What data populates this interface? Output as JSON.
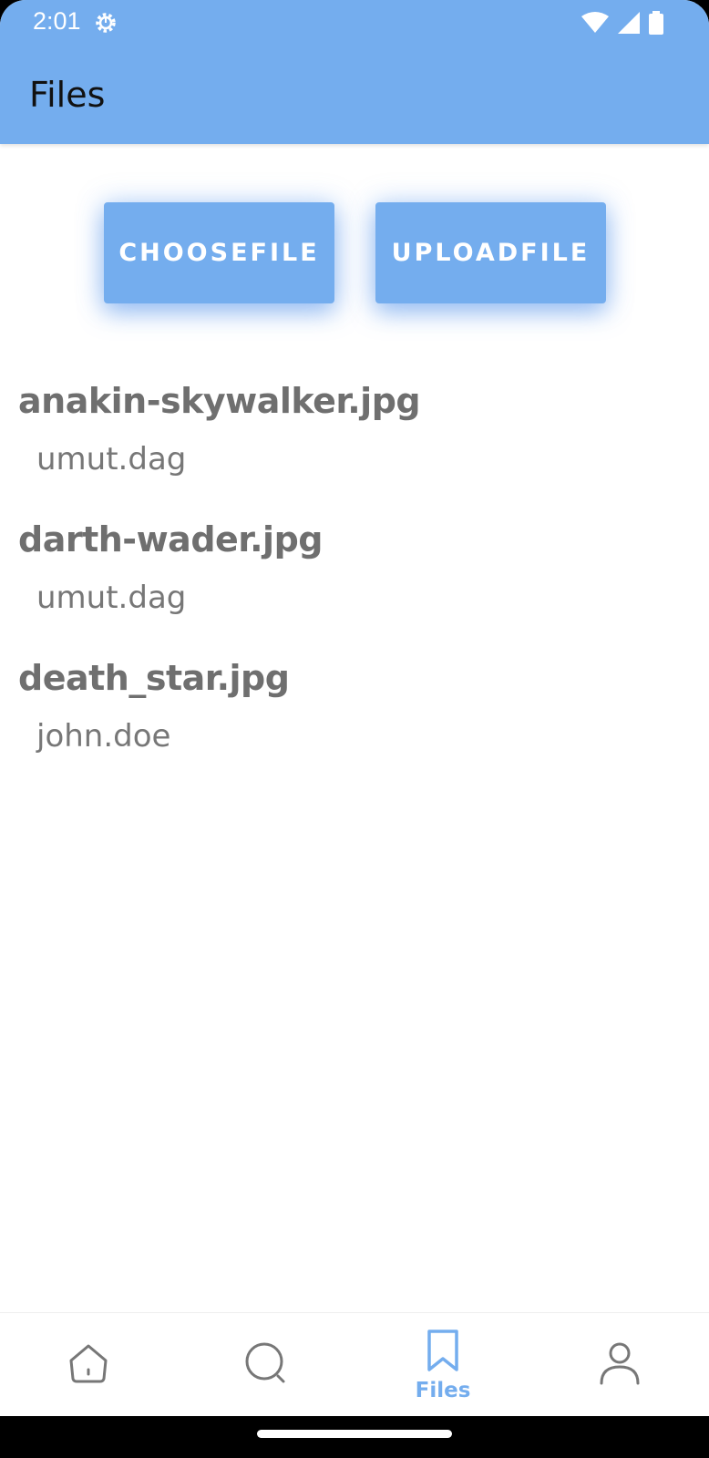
{
  "status_bar": {
    "time": "2:01",
    "icons": [
      "settings-gear-icon",
      "wifi-icon",
      "signal-icon",
      "battery-icon"
    ]
  },
  "app_bar": {
    "title": "Files",
    "background": "#74adee"
  },
  "actions": {
    "choose_label": "CHOOSEFILE",
    "upload_label": "UPLOADFILE"
  },
  "files": [
    {
      "name": "anakin-skywalker.jpg",
      "owner": "umut.dag"
    },
    {
      "name": "darth-wader.jpg",
      "owner": "umut.dag"
    },
    {
      "name": "death_star.jpg",
      "owner": "john.doe"
    }
  ],
  "bottom_nav": {
    "items": [
      {
        "icon": "home-icon",
        "label": ""
      },
      {
        "icon": "search-icon",
        "label": ""
      },
      {
        "icon": "bookmark-icon",
        "label": "Files",
        "active": true
      },
      {
        "icon": "profile-icon",
        "label": ""
      }
    ],
    "active_color": "#74adee"
  }
}
